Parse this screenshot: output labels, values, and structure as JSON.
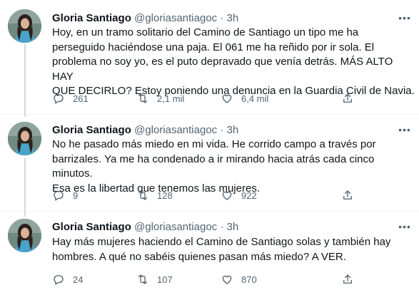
{
  "tweets": [
    {
      "name": "Gloria Santiago",
      "handle": "@gloriasantiagoc",
      "separator": "·",
      "time": "3h",
      "text": "Hoy, en un tramo solitario del Camino de Santiago un tipo me ha\nperseguido haciéndose una paja. El 061 me ha reñido por ir sola. El\nproblema no soy yo, es el puto depravado que venía detrás. MÁS ALTO HAY\nQUE DECIRLO? Estoy poniendo una denuncia en la Guardia Civil de Navia.",
      "replies": "261",
      "retweets": "2,1 mil",
      "likes": "6,4 mil"
    },
    {
      "name": "Gloria Santiago",
      "handle": "@gloriasantiagoc",
      "separator": "·",
      "time": "3h",
      "text": "No he pasado más miedo en mi vida. He corrido campo a través por\nbarrizales. Ya me ha condenado a ir mirando hacia atrás cada cinco minutos.\nEsa es la libertad que tenemos las mujeres.",
      "replies": "9",
      "retweets": "128",
      "likes": "922"
    },
    {
      "name": "Gloria Santiago",
      "handle": "@gloriasantiagoc",
      "separator": "·",
      "time": "3h",
      "text": "Hay más mujeres haciendo el Camino de Santiago solas y también hay\nhombres. A qué no sabéis quienes pasan más miedo? A VER.",
      "replies": "24",
      "retweets": "107",
      "likes": "870"
    }
  ],
  "icons": {
    "more": "more-horizontal-icon",
    "reply": "reply-icon",
    "retweet": "retweet-icon",
    "like": "heart-icon",
    "share": "share-icon"
  },
  "colors": {
    "text": "#0f1419",
    "secondary": "#536471",
    "thread_line": "#cfd9de",
    "divider": "#eff3f4"
  }
}
